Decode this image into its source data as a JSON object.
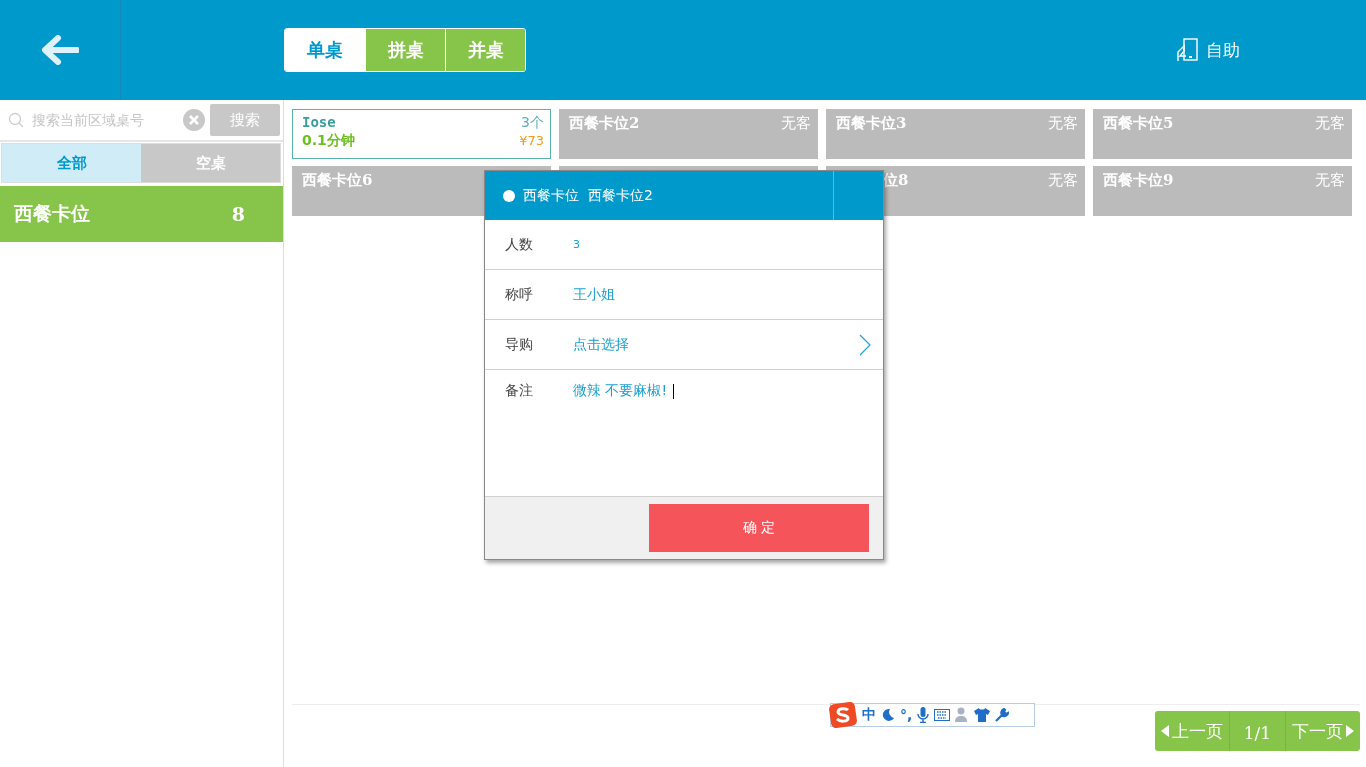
{
  "header": {
    "modes": [
      {
        "label": "单桌",
        "selected": true
      },
      {
        "label": "拼桌",
        "selected": false
      },
      {
        "label": "并桌",
        "selected": false
      }
    ],
    "self_service": "自助"
  },
  "sidebar": {
    "search": {
      "placeholder": "搜索当前区域桌号",
      "button": "搜索"
    },
    "tabs": [
      {
        "label": "全部",
        "selected": true
      },
      {
        "label": "空桌",
        "selected": false
      }
    ],
    "areas": [
      {
        "name": "西餐卡位",
        "count": "8",
        "selected": true
      }
    ]
  },
  "tables": [
    {
      "kind": "occupied",
      "name": "Iose",
      "guests": "3个",
      "time": "0.1分钟",
      "amount": "¥73"
    },
    {
      "kind": "empty",
      "name": "西餐卡位2",
      "status": "无客"
    },
    {
      "kind": "empty",
      "name": "西餐卡位3",
      "status": "无客"
    },
    {
      "kind": "empty",
      "name": "西餐卡位5",
      "status": "无客"
    },
    {
      "kind": "empty",
      "name": "西餐卡位6"
    },
    {
      "kind": "hidden"
    },
    {
      "kind": "covered",
      "name": "位8",
      "status": "无客"
    },
    {
      "kind": "empty",
      "name": "西餐卡位9",
      "status": "无客"
    }
  ],
  "dialog": {
    "title": "西餐卡位  西餐卡位2",
    "fields": [
      {
        "kind": "text",
        "label": "人数",
        "value": "3"
      },
      {
        "kind": "text",
        "label": "称呼",
        "value": "王小姐"
      },
      {
        "kind": "select",
        "label": "导购",
        "value": "点击选择"
      },
      {
        "kind": "textarea",
        "label": "备注",
        "value": "微辣 不要麻椒!"
      }
    ],
    "confirm": "确 定"
  },
  "ime": {
    "mode": "中",
    "punct": "°,"
  },
  "pager": {
    "prev": "上一页",
    "page": "1/1",
    "next": "下一页"
  }
}
